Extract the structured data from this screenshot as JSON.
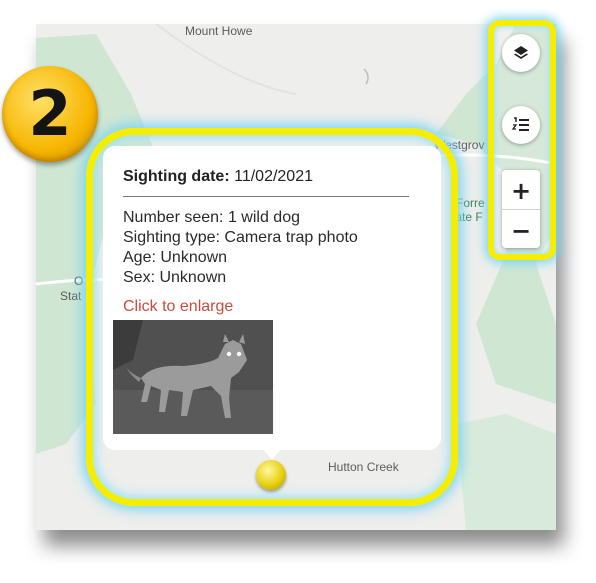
{
  "step_badge": {
    "number": "2"
  },
  "map": {
    "labels": {
      "mount_howe": "Mount Howe",
      "westgrove": "Westgrov",
      "forrest": "Forre",
      "state_f": "tate F",
      "left_o": "O",
      "left_stat": "Stat",
      "hutton_creek": "Hutton Creek"
    }
  },
  "controls": {
    "layers_icon": "layers-icon",
    "legend_icon": "legend-list-icon",
    "zoom_in": "+",
    "zoom_out": "−"
  },
  "popup": {
    "date_label": "Sighting date:",
    "date_value": "11/02/2021",
    "number_seen": "Number seen: 1 wild dog",
    "sighting_type": "Sighting type: Camera trap photo",
    "age": "Age: Unknown",
    "sex": "Sex: Unknown",
    "enlarge_link": "Click to enlarge"
  },
  "colors": {
    "highlight": "#f5ee00",
    "glow": "#7fd6f0",
    "link": "#cc4a3d",
    "map_green": "#cfe6d3",
    "map_bg": "#eeeeec",
    "marker": "#e8d010"
  }
}
